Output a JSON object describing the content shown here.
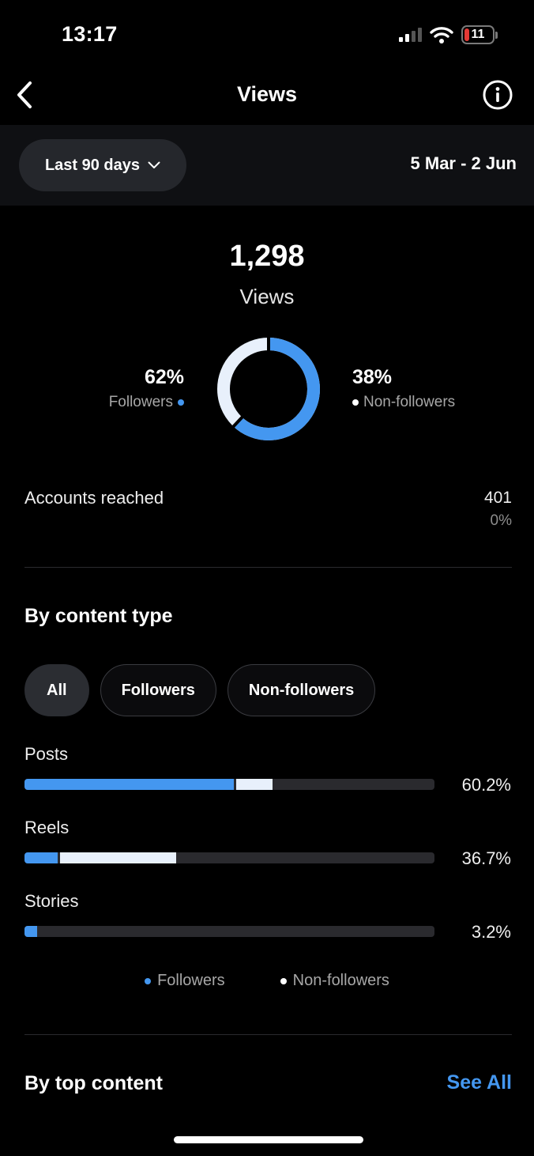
{
  "status_bar": {
    "time": "13:17",
    "battery": "11"
  },
  "header": {
    "title": "Views"
  },
  "filter": {
    "range_label": "Last 90 days",
    "date_range": "5 Mar - 2 Jun"
  },
  "summary": {
    "total": "1,298",
    "total_label": "Views",
    "followers_pct": "62%",
    "followers_label": "Followers",
    "followers_fraction": 0.62,
    "nonfollowers_pct": "38%",
    "nonfollowers_label": "Non-followers"
  },
  "reach": {
    "label": "Accounts reached",
    "value": "401",
    "change": "0%"
  },
  "content_type": {
    "title": "By content type",
    "tabs": [
      "All",
      "Followers",
      "Non-followers"
    ],
    "active_tab": "All",
    "rows": [
      {
        "label": "Posts",
        "pct": "60.2%",
        "followers_share": 0.51,
        "nonfollowers_share": 0.09
      },
      {
        "label": "Reels",
        "pct": "36.7%",
        "followers_share": 0.08,
        "nonfollowers_share": 0.285
      },
      {
        "label": "Stories",
        "pct": "3.2%",
        "followers_share": 0.03,
        "nonfollowers_share": 0.0
      }
    ],
    "legend": {
      "followers": "Followers",
      "nonfollowers": "Non-followers"
    }
  },
  "top_content": {
    "title": "By top content",
    "see_all": "See All"
  },
  "colors": {
    "followers": "#4497f0",
    "nonfollowers": "#e8f0fb",
    "accent": "#4497f0"
  }
}
